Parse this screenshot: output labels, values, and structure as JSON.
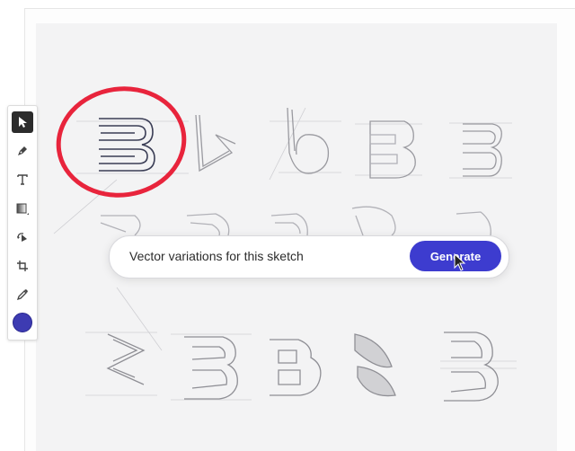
{
  "toolbar": {
    "tools": [
      {
        "name": "select-tool",
        "icon": "arrow-pointer-icon",
        "active": true
      },
      {
        "name": "pen-tool",
        "icon": "pen-icon"
      },
      {
        "name": "text-tool",
        "icon": "text-T-icon"
      },
      {
        "name": "gradient-tool",
        "icon": "gradient-icon"
      },
      {
        "name": "rotate-tool",
        "icon": "rotate-shape-icon"
      },
      {
        "name": "crop-tool",
        "icon": "crop-icon"
      },
      {
        "name": "eyedropper-tool",
        "icon": "eyedropper-icon"
      }
    ],
    "fill_color": "#3d3bb2"
  },
  "prompt": {
    "text": "Vector variations for this sketch",
    "button_label": "Generate"
  },
  "colors": {
    "accent": "#3d3ccf",
    "highlight_circle": "#e8243c",
    "sketch": "#8a8a8f"
  }
}
